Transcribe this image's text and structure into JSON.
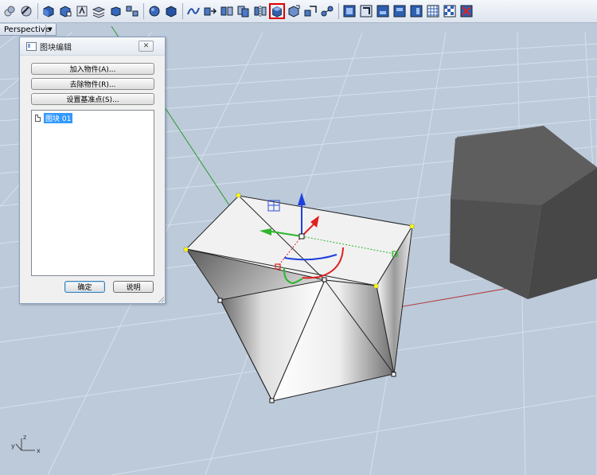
{
  "toolbar": {
    "groups": [
      [
        "materials-icon",
        "rotate-view-icon"
      ],
      [
        "shaded-box-icon",
        "box-edit-icon",
        "text-object-icon",
        "layer-stack-icon",
        "cube-icon",
        "array-icon"
      ],
      [
        "sphere-icon",
        "blue-cube-icon"
      ],
      [
        "curve-icon",
        "move-icon",
        "extrude-icon",
        "copy-icon",
        "mirror-icon",
        "block-edit-icon",
        "extract-icon",
        "scale-icon",
        "connect-icon"
      ],
      [
        "front-view-icon",
        "side-view-icon",
        "back-view-icon",
        "top-view-icon",
        "bottom-view-icon",
        "grid-view-icon",
        "checker-icon",
        "no-render-icon"
      ]
    ],
    "active_tool": "block-edit-icon"
  },
  "viewport": {
    "name": "Perspective",
    "dropdown_symbol": "▼",
    "axis_labels": {
      "x": "x",
      "y": "y",
      "z": "z"
    }
  },
  "panel": {
    "title": "图块编辑",
    "close_symbol": "✕",
    "add_button": "加入物件(A)...",
    "remove_button": "去除物件(R)...",
    "basepoint_button": "设置基准点(S)...",
    "tree_item": "图块 01",
    "ok_button": "确定",
    "explain_button": "说明"
  },
  "colors": {
    "viewport_bg": "#bccada",
    "grid_line": "#d8e1ec",
    "axis_x": "#b33a3a",
    "axis_y": "#2a9a2a",
    "gumball_z": "#1f3fdd",
    "gumball_y": "#2db52d",
    "gumball_x": "#e02020",
    "grip": "#ffff00",
    "dark_box": "#555555",
    "highlight": "#e00000"
  }
}
